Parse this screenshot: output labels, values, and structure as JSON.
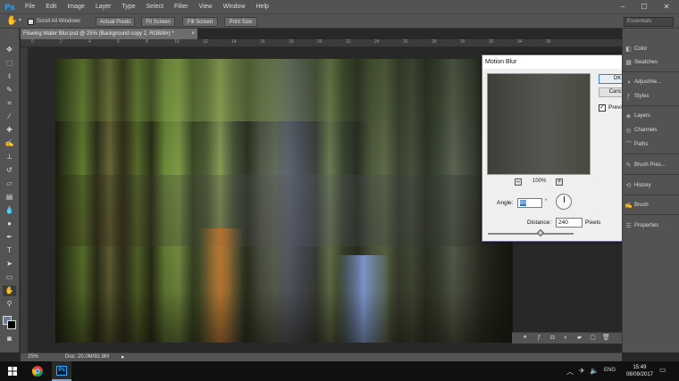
{
  "app": {
    "logo": "Ps"
  },
  "menu": [
    "File",
    "Edit",
    "Image",
    "Layer",
    "Type",
    "Select",
    "Filter",
    "View",
    "Window",
    "Help"
  ],
  "window_controls": {
    "minimize": "–",
    "maximize": "☐",
    "close": "✕"
  },
  "options_bar": {
    "scroll_all_windows": "Scroll All Windows",
    "actual_pixels": "Actual Pixels",
    "fit_screen": "Fit Screen",
    "fill_screen": "Fill Screen",
    "print_size": "Print Size",
    "workspace": "Essentials"
  },
  "document": {
    "tab_title": "Flowing Water Blur.psd @ 25% (Background copy 2, RGB/8#) *",
    "close": "×"
  },
  "ruler_ticks": [
    "0",
    "2",
    "4",
    "6",
    "8",
    "10",
    "12",
    "14",
    "16",
    "18",
    "20",
    "22",
    "24",
    "26",
    "28",
    "30",
    "32",
    "34",
    "36"
  ],
  "tools": [
    "move-tool",
    "marquee-tool",
    "lasso-tool",
    "quick-select-tool",
    "crop-tool",
    "eyedropper-tool",
    "healing-tool",
    "brush-tool",
    "stamp-tool",
    "history-brush-tool",
    "eraser-tool",
    "gradient-tool",
    "blur-tool",
    "dodge-tool",
    "pen-tool",
    "type-tool",
    "path-select-tool",
    "shape-tool",
    "hand-tool",
    "zoom-tool"
  ],
  "dialog": {
    "title": "Motion Blur",
    "close": "✕",
    "ok": "OK",
    "cancel": "Cancel",
    "preview_label": "Preview",
    "preview_checked": true,
    "zoom_level": "100%",
    "zoom_out": "–",
    "zoom_in": "+",
    "angle_label": "Angle:",
    "angle_value": "90",
    "angle_unit": "°",
    "distance_label": "Distance:",
    "distance_value": "240",
    "distance_unit": "Pixels"
  },
  "right_panels": [
    {
      "icon": "color-icon",
      "label": "Color"
    },
    {
      "icon": "swatches-icon",
      "label": "Swatches"
    },
    {
      "icon": "adjustments-icon",
      "label": "Adjustme..."
    },
    {
      "icon": "styles-icon",
      "label": "Styles"
    },
    {
      "icon": "layers-icon",
      "label": "Layers"
    },
    {
      "icon": "channels-icon",
      "label": "Channels"
    },
    {
      "icon": "paths-icon",
      "label": "Paths"
    },
    {
      "icon": "brush-presets-icon",
      "label": "Brush Pres..."
    },
    {
      "icon": "history-icon",
      "label": "History"
    },
    {
      "icon": "brush-icon",
      "label": "Brush"
    },
    {
      "icon": "properties-icon",
      "label": "Properties"
    }
  ],
  "status": {
    "zoom": "25%",
    "doc": "Doc: 20.0M/92.8M"
  },
  "taskbar": {
    "language": "ENG",
    "time": "15:49",
    "date": "08/09/2017"
  }
}
